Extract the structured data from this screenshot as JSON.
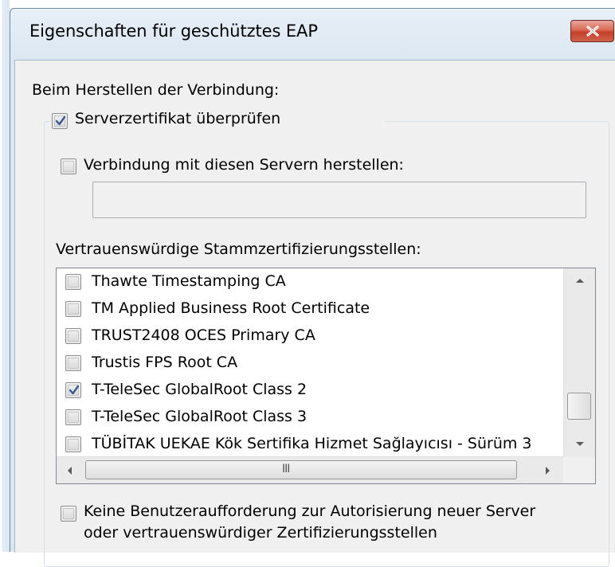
{
  "dialog": {
    "title": "Eigenschaften für geschütztes EAP",
    "close_icon": "close-icon"
  },
  "section_label": "Beim Herstellen der Verbindung:",
  "verify_cert": {
    "label": "Serverzertifikat überprüfen",
    "checked": true
  },
  "connect_servers": {
    "label": "Verbindung mit diesen Servern herstellen:",
    "checked": false,
    "value": ""
  },
  "trusted_roots": {
    "label": "Vertrauenswürdige Stammzertifizierungsstellen:",
    "items": [
      {
        "label": "Thawte Timestamping CA",
        "checked": false
      },
      {
        "label": "TM Applied Business Root Certificate",
        "checked": false
      },
      {
        "label": "TRUST2408 OCES Primary CA",
        "checked": false
      },
      {
        "label": "Trustis FPS Root CA",
        "checked": false
      },
      {
        "label": "T-TeleSec GlobalRoot Class 2",
        "checked": true
      },
      {
        "label": "T-TeleSec GlobalRoot Class 3",
        "checked": false
      },
      {
        "label": "TÜBİTAK UEKAE Kök Sertifika Hizmet Sağlayıcısı - Sürüm 3",
        "checked": false
      }
    ],
    "hscroll_grip": "III"
  },
  "no_prompt": {
    "label_line1": "Keine Benutzeraufforderung zur Autorisierung neuer Server",
    "label_line2": "oder vertrauenswürdiger Zertifizierungsstellen",
    "checked": false
  }
}
